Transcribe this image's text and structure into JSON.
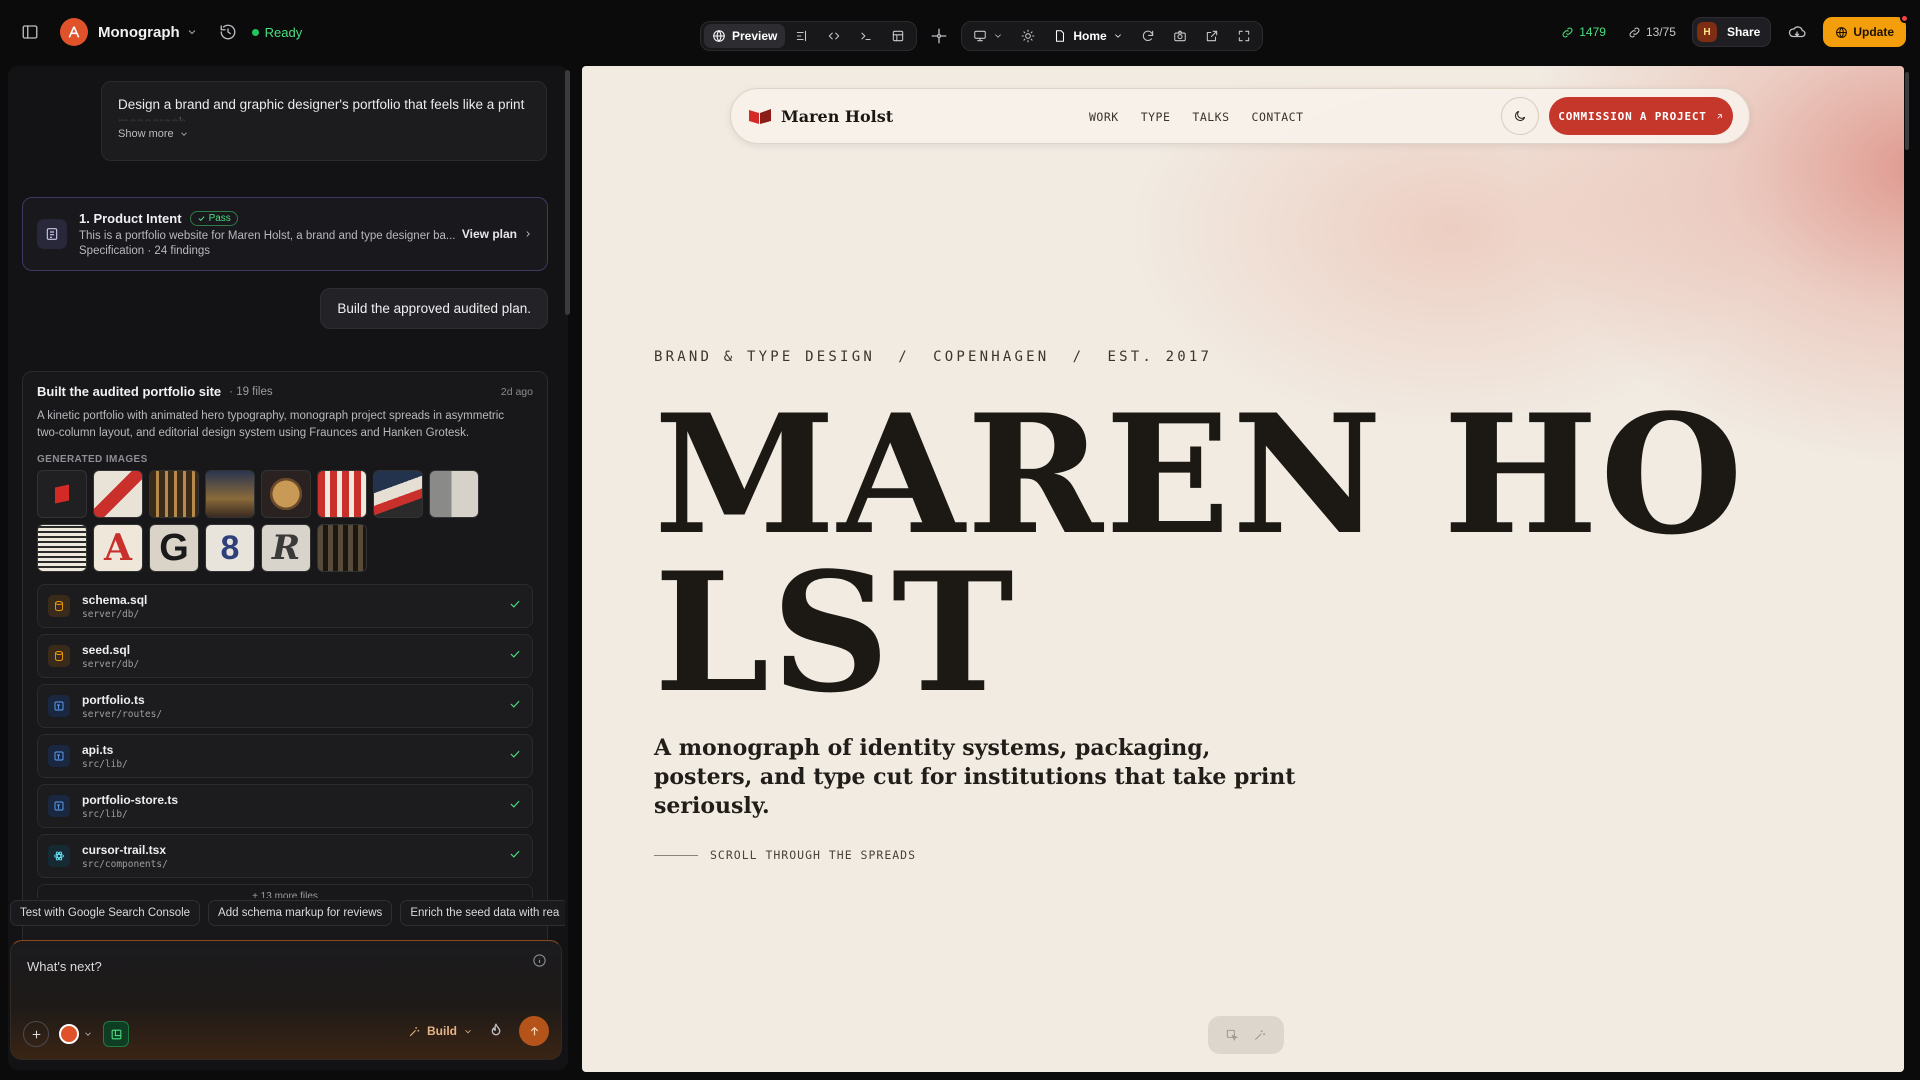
{
  "topbar": {
    "project_name": "Monograph",
    "status": "Ready",
    "preview_label": "Preview",
    "page_select": "Home",
    "credits": "1479",
    "usage": "13/75",
    "avatar_initial": "H",
    "share_label": "Share",
    "update_label": "Update"
  },
  "chat": {
    "prompt_text": "Design a brand and graphic designer's portfolio that feels like a print monograph",
    "show_more": "Show more",
    "intent": {
      "title": "1. Product Intent",
      "badge": "Pass",
      "description": "This is a portfolio website for Maren Holst, a brand and type designer ba...",
      "meta": "Specification · 24 findings",
      "action": "View plan"
    },
    "user_message": "Build the approved audited plan.",
    "built": {
      "title": "Built the audited portfolio site",
      "file_count": "· 19 files",
      "time": "2d ago",
      "description": "A kinetic portfolio with animated hero typography, monograph project spreads in asymmetric two-column layout, and editorial design system using Fraunces and Hanken Grotesk.",
      "generated_label": "GENERATED IMAGES",
      "thumb_glyphs": [
        "A",
        "G",
        "8",
        "R"
      ],
      "files": [
        {
          "name": "schema.sql",
          "path": "server/db/",
          "icon": "database-icon"
        },
        {
          "name": "seed.sql",
          "path": "server/db/",
          "icon": "database-icon"
        },
        {
          "name": "portfolio.ts",
          "path": "server/routes/",
          "icon": "typescript-icon"
        },
        {
          "name": "api.ts",
          "path": "src/lib/",
          "icon": "typescript-icon"
        },
        {
          "name": "portfolio-store.ts",
          "path": "src/lib/",
          "icon": "typescript-icon"
        },
        {
          "name": "cursor-trail.tsx",
          "path": "src/components/",
          "icon": "react-icon"
        }
      ],
      "more_files": "+ 13 more files"
    },
    "suggestions": [
      "Test with Google Search Console",
      "Add schema markup for reviews",
      "Enrich the seed data with rea"
    ],
    "composer_placeholder": "What's next?",
    "build_mode": "Build"
  },
  "site": {
    "brand_name": "Maren Holst",
    "nav_links": [
      "WORK",
      "TYPE",
      "TALKS",
      "CONTACT"
    ],
    "cta": "COMMISSION A PROJECT",
    "eyebrow": "BRAND & TYPE DESIGN  /  COPENHAGEN  /  EST. 2017",
    "hero_line1": "MAREN HO",
    "hero_line2": "LST",
    "lede": "A monograph of identity systems, packaging, posters, and type cut for institutions that take print seriously.",
    "scroll_cue": "SCROLL THROUGH THE SPREADS"
  },
  "colors": {
    "accent_orange": "#f59e0b",
    "status_green": "#22c55e",
    "site_background": "#f1ebe2",
    "site_red": "#c5362b",
    "site_ink": "#1c1915"
  }
}
